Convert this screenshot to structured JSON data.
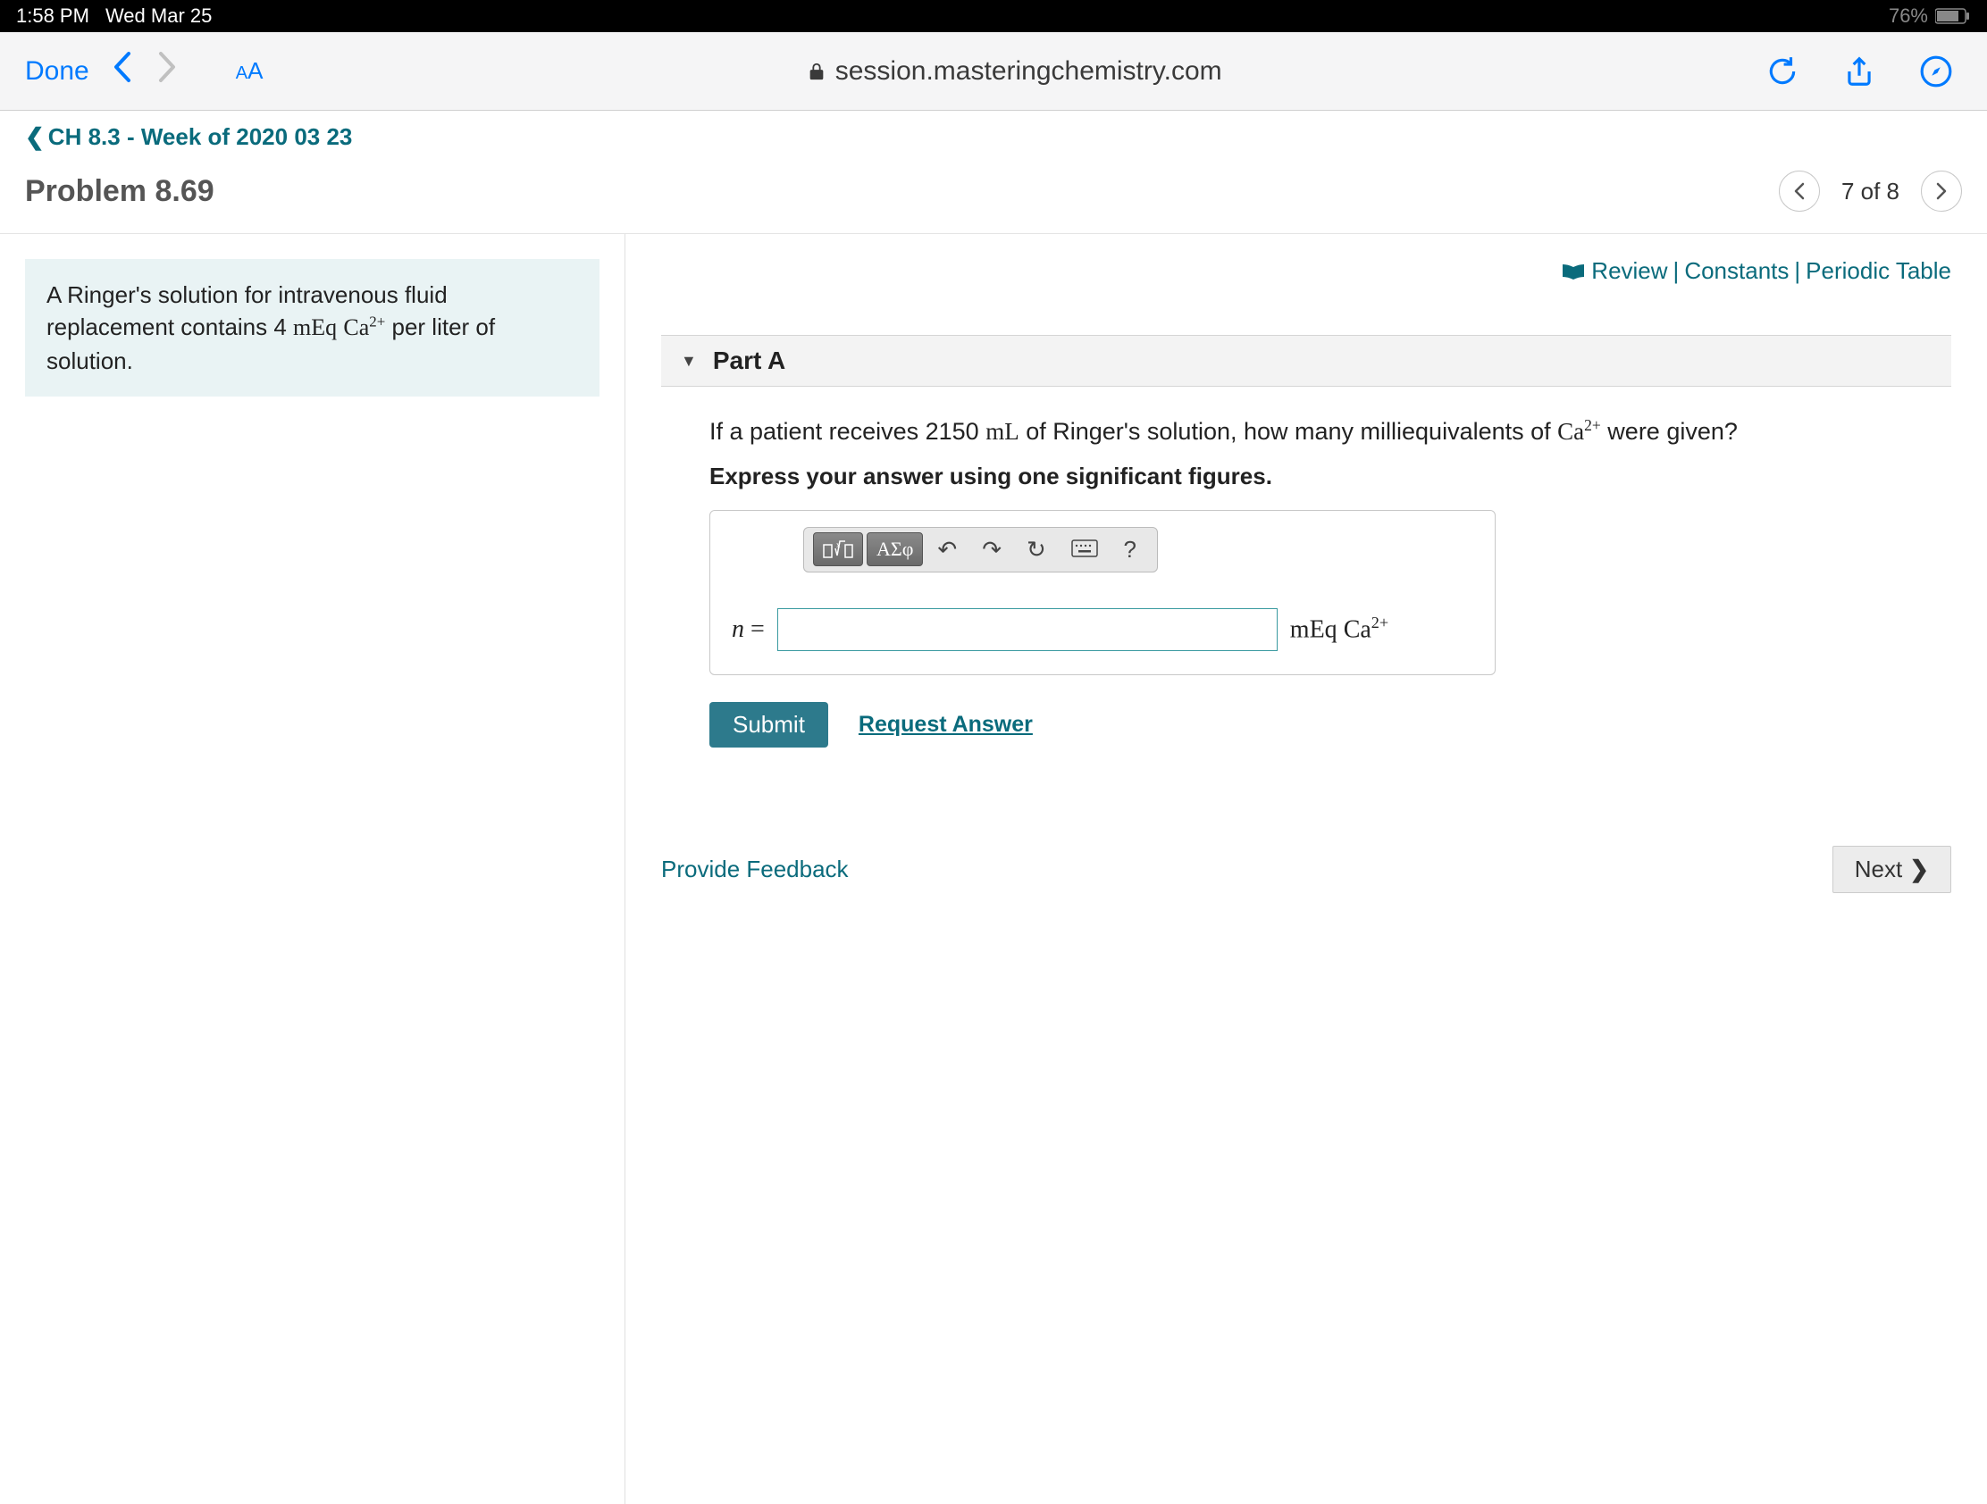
{
  "status": {
    "time": "1:58 PM",
    "date": "Wed Mar 25",
    "battery": "76%"
  },
  "safari": {
    "done": "Done",
    "aa": "AA",
    "url": "session.masteringchemistry.com"
  },
  "breadcrumb": "CH 8.3 - Week of 2020 03 23",
  "problem_title": "Problem 8.69",
  "pager": {
    "text": "7 of 8"
  },
  "refs": {
    "review": "Review",
    "constants": "Constants",
    "periodic": "Periodic Table"
  },
  "context": {
    "pre": "A Ringer's solution for intravenous fluid replacement contains 4 ",
    "unit": "mEq",
    "ion": "Ca",
    "charge": "2+",
    "post": " per liter of solution."
  },
  "part": {
    "label": "Part A",
    "q_pre": "If a patient receives 2150 ",
    "q_unit": "mL",
    "q_mid": " of Ringer's solution, how many milliequivalents of ",
    "q_ion": "Ca",
    "q_charge": "2+",
    "q_post": " were given?",
    "instruction": "Express your answer using one significant figures."
  },
  "tools": {
    "greek": "ΑΣφ",
    "undo": "↶",
    "redo": "↷",
    "reset": "↻",
    "help": "?"
  },
  "answer": {
    "var": "n",
    "eq": " = ",
    "value": "",
    "unit_pre": "mEq ",
    "unit_ion": "Ca",
    "unit_charge": "2+"
  },
  "buttons": {
    "submit": "Submit",
    "request": "Request Answer",
    "feedback": "Provide Feedback",
    "next": "Next"
  }
}
